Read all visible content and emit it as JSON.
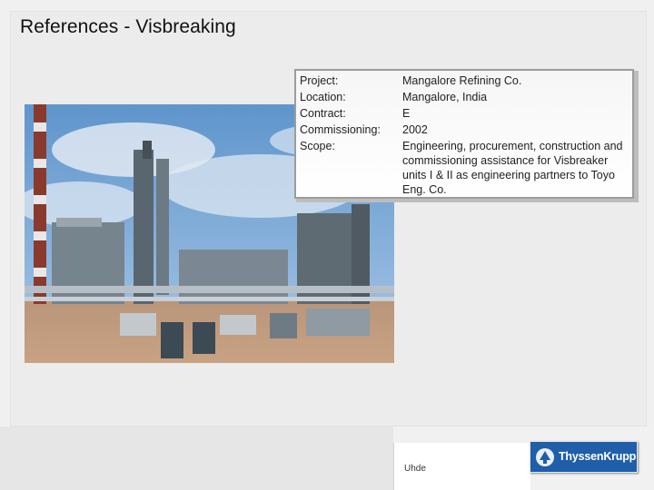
{
  "slide": {
    "title": "References - Visbreaking"
  },
  "project_info": {
    "rows": [
      {
        "label": "Project:",
        "value": "Mangalore Refining Co."
      },
      {
        "label": "Location:",
        "value": "Mangalore, India"
      },
      {
        "label": "Contract:",
        "value": "E"
      },
      {
        "label": "Commissioning:",
        "value": "2002"
      },
      {
        "label": "Scope:",
        "value": ""
      }
    ],
    "scope_text": "Engineering, procurement, construction and commissioning assistance for Visbreaker units I & II as engineering partners to Toyo Eng. Co."
  },
  "footer": {
    "uhde_label": "Uhde",
    "logo_text": "ThyssenKrupp"
  },
  "colors": {
    "logo_blue": "#1f5ea8",
    "info_border": "#9c9c9c"
  }
}
